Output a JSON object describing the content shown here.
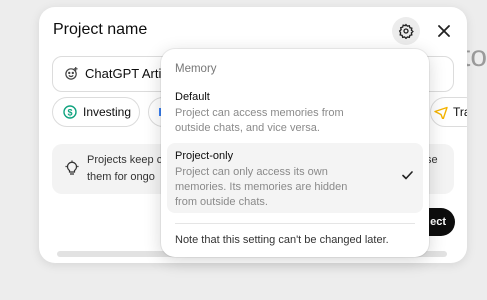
{
  "background": {
    "partial_text": "to"
  },
  "modal": {
    "title": "Project name",
    "name_input": {
      "value": "ChatGPT Artic"
    },
    "chips": [
      {
        "label": "Investing",
        "icon": "dollar-circle-icon",
        "color": "#10a37f"
      },
      {
        "label": "",
        "icon": "partial-chip-icon",
        "color": "#3b82f6"
      },
      {
        "label": "Tra",
        "icon": "plane-icon",
        "color": "#f5b400"
      }
    ],
    "info": {
      "line1": "Projects keep c",
      "line2": "them for ongo",
      "tail": "se"
    },
    "create_button_label": "ect"
  },
  "memory_menu": {
    "header": "Memory",
    "options": [
      {
        "title": "Default",
        "desc_lines": [
          "Project can access memories from",
          "outside chats, and vice versa."
        ],
        "selected": false
      },
      {
        "title": "Project-only",
        "desc_lines": [
          "Project can only access its own",
          "memories. Its memories are hidden",
          "from outside chats."
        ],
        "selected": true
      }
    ],
    "note": "Note that this setting can't be changed later."
  },
  "colors": {
    "accent_dark": "#0d0d0d",
    "muted": "#8a8a8a",
    "bg": "#ededed"
  }
}
